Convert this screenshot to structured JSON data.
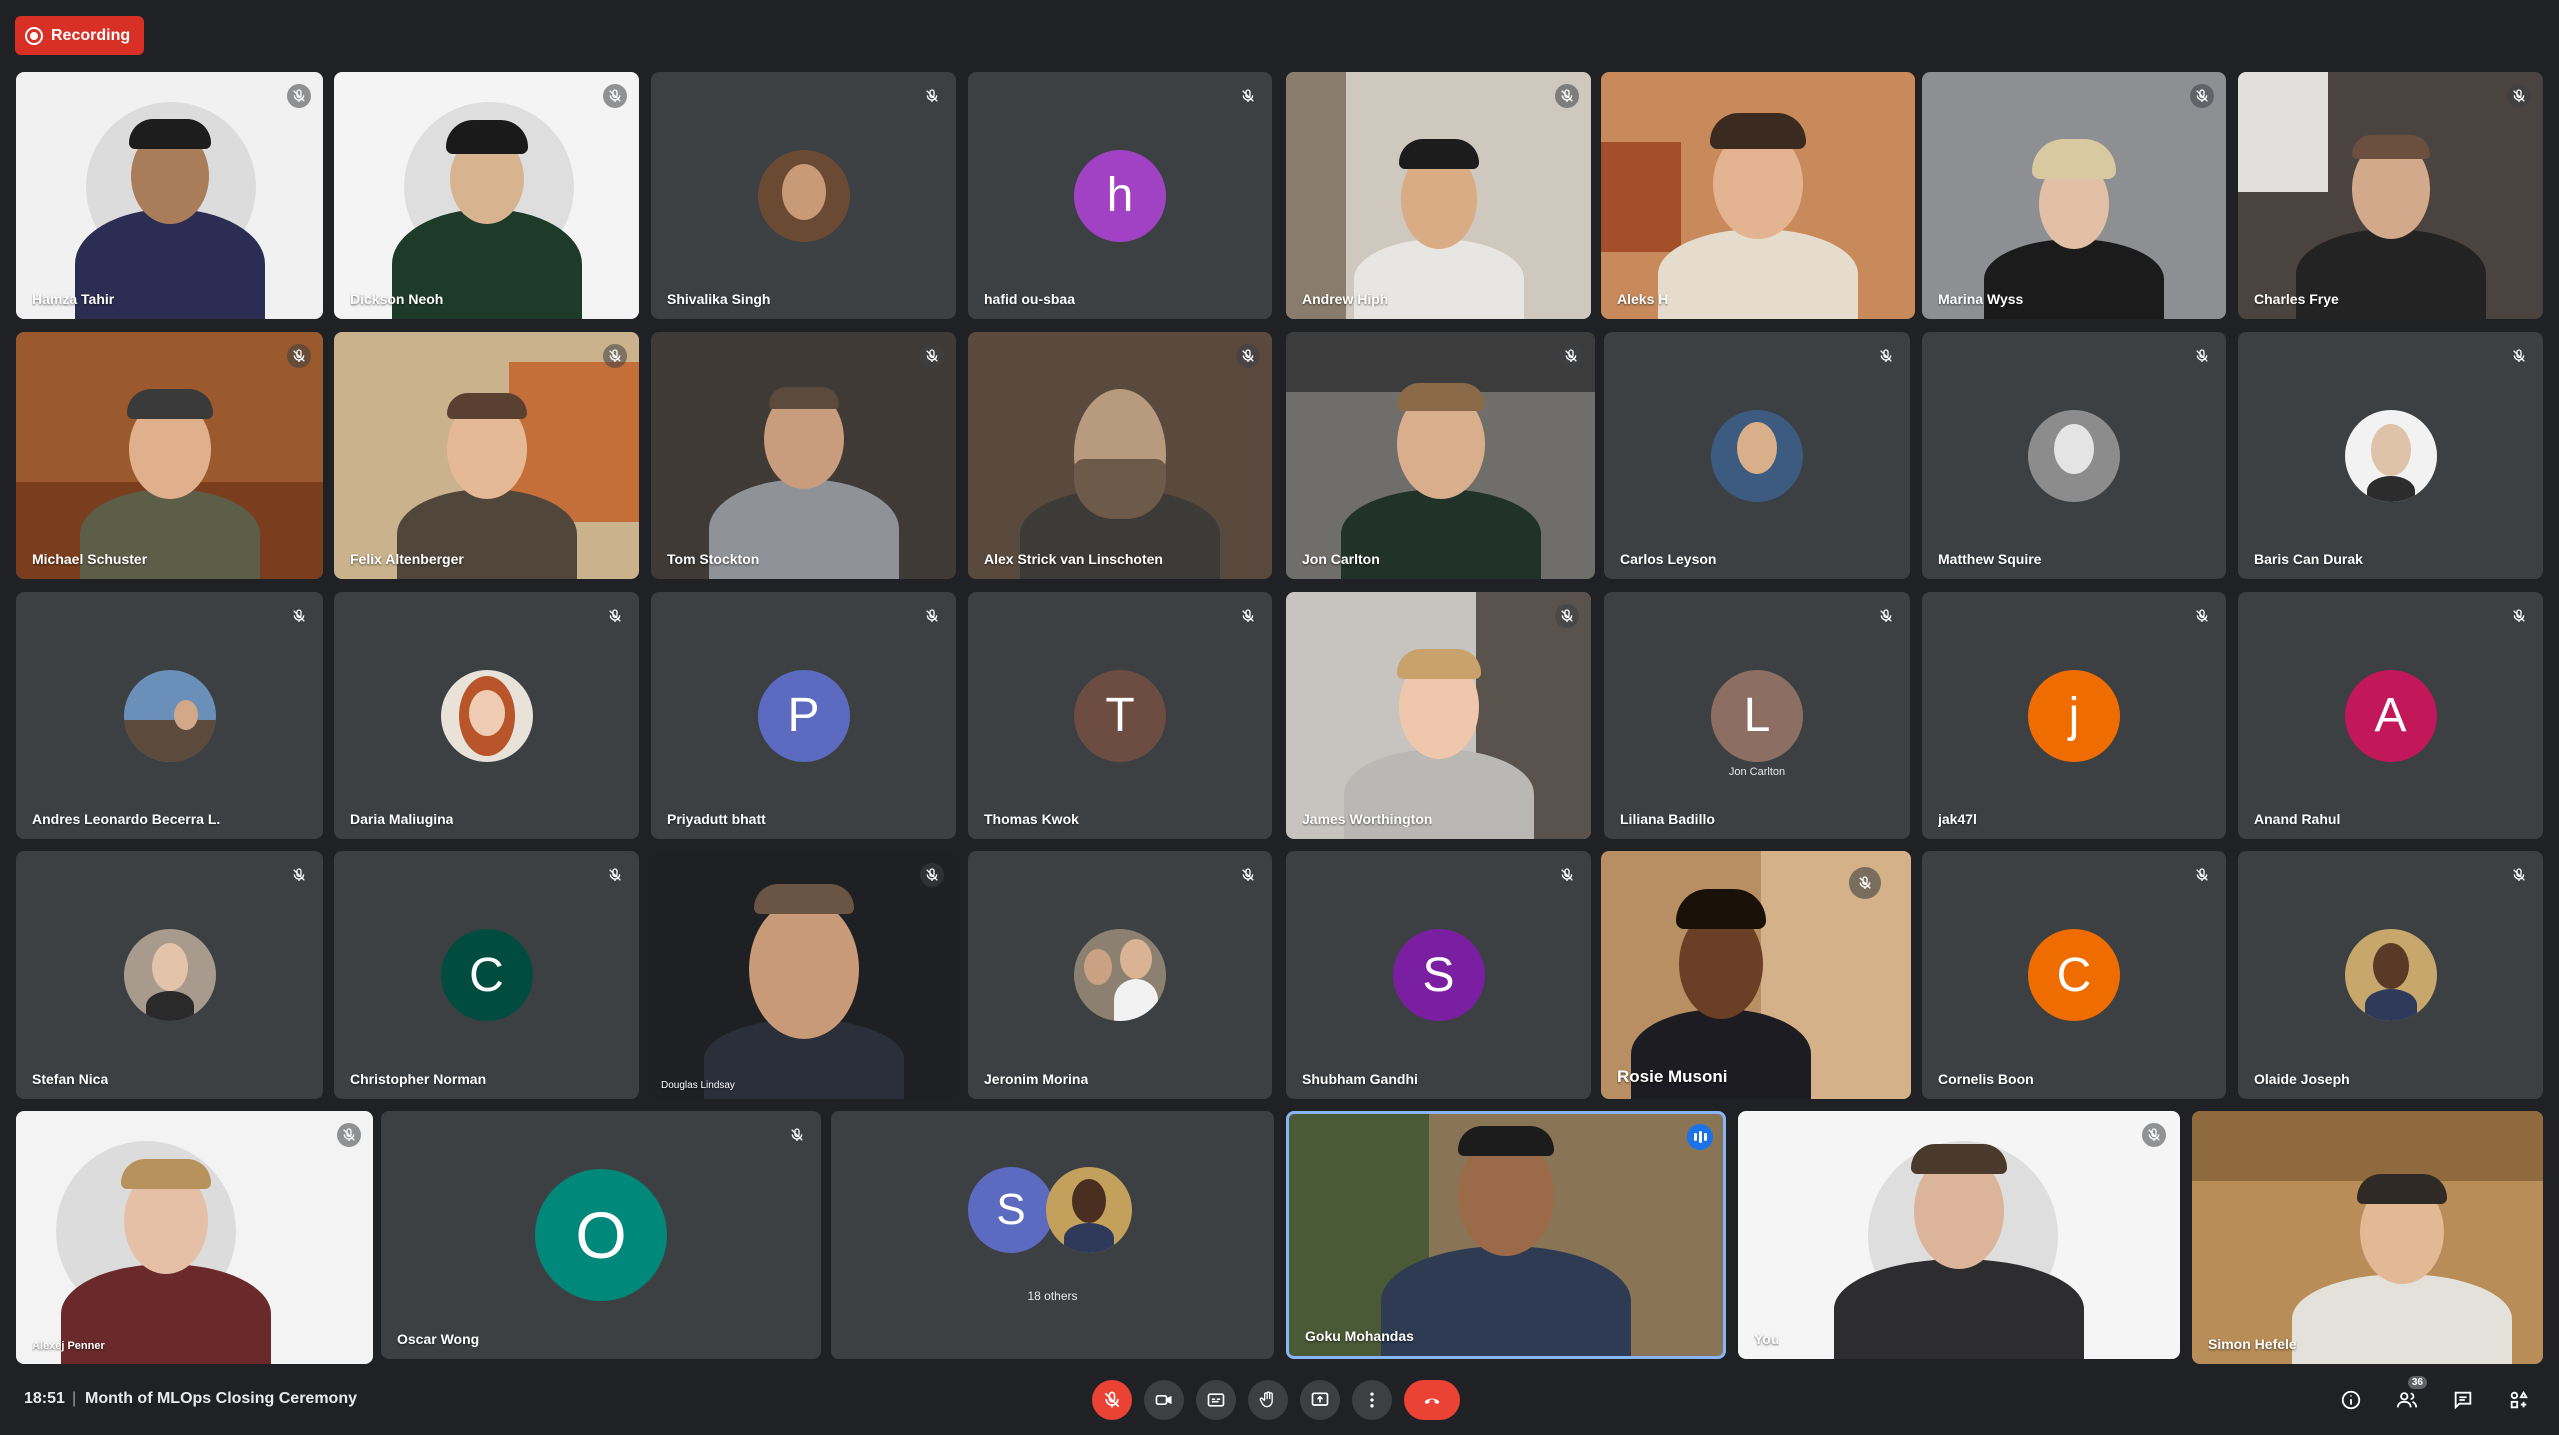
{
  "recording": {
    "label": "Recording"
  },
  "meeting": {
    "time": "18:51",
    "separator": "|",
    "title": "Month of MLOps Closing Ceremony"
  },
  "participants_badge": "36",
  "tiles": {
    "hamza": {
      "name": "Hamza Tahir"
    },
    "dickson": {
      "name": "Dickson Neoh"
    },
    "shivalika": {
      "name": "Shivalika Singh"
    },
    "hafid": {
      "name": "hafid ou-sbaa",
      "initial": "h"
    },
    "andrew": {
      "name": "Andrew Hiph"
    },
    "aleks": {
      "name": "Aleks H"
    },
    "marina": {
      "name": "Marina Wyss"
    },
    "charles": {
      "name": "Charles Frye"
    },
    "michael": {
      "name": "Michael Schuster"
    },
    "felix": {
      "name": "Felix Altenberger"
    },
    "tom": {
      "name": "Tom Stockton"
    },
    "alex_strick": {
      "name": "Alex Strick van Linschoten"
    },
    "jon": {
      "name": "Jon Carlton"
    },
    "carlos": {
      "name": "Carlos Leyson"
    },
    "matthew": {
      "name": "Matthew Squire"
    },
    "baris": {
      "name": "Baris Can Durak"
    },
    "andres": {
      "name": "Andres Leonardo Becerra L."
    },
    "daria": {
      "name": "Daria Maliugina"
    },
    "priyadutt": {
      "name": "Priyadutt bhatt",
      "initial": "P"
    },
    "thomas": {
      "name": "Thomas Kwok",
      "initial": "T"
    },
    "james": {
      "name": "James Worthington"
    },
    "liliana": {
      "name": "Liliana Badillo",
      "initial": "L",
      "sublabel": "Jon Carlton"
    },
    "jak": {
      "name": "jak47l",
      "initial": "j"
    },
    "anand": {
      "name": "Anand Rahul",
      "initial": "A"
    },
    "stefan": {
      "name": "Stefan Nica"
    },
    "christopher": {
      "name": "Christopher Norman",
      "initial": "C"
    },
    "douglas": {
      "name": "Douglas Lindsay"
    },
    "jeronim": {
      "name": "Jeronim Morina"
    },
    "shubham": {
      "name": "Shubham Gandhi",
      "initial": "S"
    },
    "rosie": {
      "name": "Rosie Musoni"
    },
    "cornelis": {
      "name": "Cornelis Boon",
      "initial": "C"
    },
    "olaide": {
      "name": "Olaide Joseph"
    },
    "alexej": {
      "name": "Alexej Penner"
    },
    "oscar": {
      "name": "Oscar Wong",
      "initial": "O"
    },
    "others": {
      "label": "18 others",
      "initial": "S"
    },
    "goku": {
      "name": "Goku Mohandas"
    },
    "you": {
      "name": "You"
    },
    "simon": {
      "name": "Simon Hefele"
    }
  },
  "colors": {
    "tile_bg": "#3c4043",
    "page_bg": "#202124",
    "recording": "#d93025",
    "end_call": "#ea4335",
    "active_border": "#8ab4f8"
  }
}
